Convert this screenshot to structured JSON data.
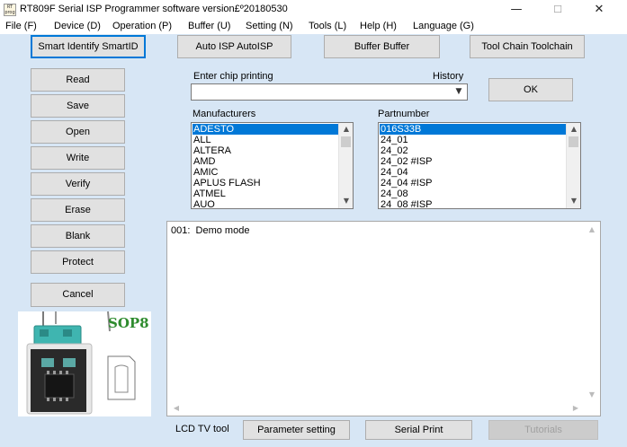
{
  "window": {
    "icon_text": "RT\nprog",
    "title": "RT809F Serial ISP Programmer software version£º20180530",
    "minimize": "—",
    "maximize": "☐",
    "close": "✕"
  },
  "menu": [
    "File (F)",
    "Device (D)",
    "Operation (P)",
    "Buffer (U)",
    "Setting (N)",
    "Tools (L)",
    "Help (H)",
    "Language (G)"
  ],
  "toolbar": {
    "smart_identify": "Smart Identify SmartID",
    "auto_isp": "Auto ISP AutoISP",
    "buffer": "Buffer Buffer",
    "toolchain": "Tool Chain Toolchain"
  },
  "side_buttons": {
    "read": "Read",
    "save": "Save",
    "open": "Open",
    "write": "Write",
    "verify": "Verify",
    "erase": "Erase",
    "blank": "Blank",
    "protect": "Protect",
    "cancel": "Cancel"
  },
  "chip_search": {
    "label": "Enter chip printing",
    "history_label": "History",
    "value": "",
    "ok": "OK"
  },
  "manufacturers": {
    "label": "Manufacturers",
    "items": [
      "ADESTO",
      "ALL",
      "ALTERA",
      "AMD",
      "AMIC",
      "APLUS FLASH",
      "ATMEL",
      "AUO"
    ],
    "selected": "ADESTO"
  },
  "partnumbers": {
    "label": "Partnumber",
    "items": [
      "016S33B",
      "24_01",
      "24_02",
      "24_02 #ISP",
      "24_04",
      "24_04 #ISP",
      "24_08",
      "24_08 #ISP"
    ],
    "selected": "016S33B"
  },
  "log": {
    "lines": [
      "001:  Demo mode"
    ]
  },
  "socket": {
    "label": "SOP8",
    "label_color": "#2e8b2e",
    "adapter_color": "#3fb5b0"
  },
  "bottom": {
    "lcd_label": "LCD TV tool",
    "parameter_setting": "Parameter setting",
    "serial_print": "Serial Print",
    "tutorials": "Tutorials"
  },
  "colors": {
    "client_bg": "#d7e6f5",
    "selection": "#0078d7"
  }
}
